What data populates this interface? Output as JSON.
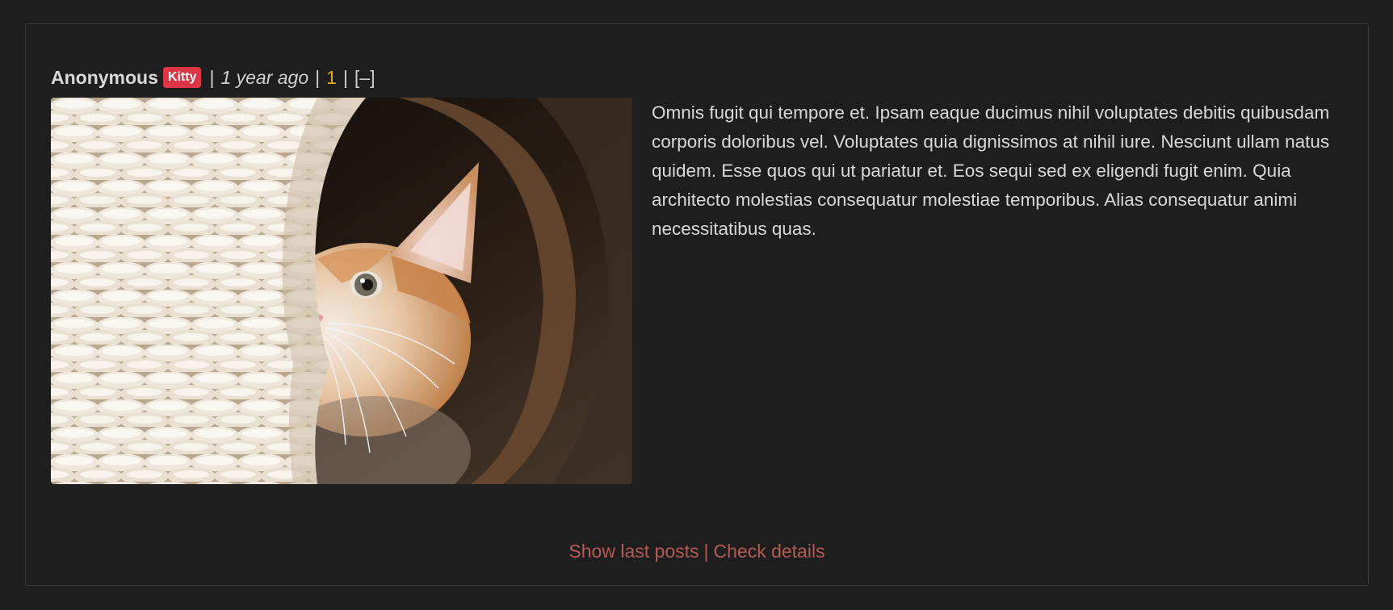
{
  "post": {
    "author": "Anonymous",
    "badge": "Kitty",
    "separator": "|",
    "timestamp": "1 year ago",
    "post_number": "1",
    "collapse_label": "[–]",
    "image_subject": "kitten-peeking-from-wicker-basket",
    "body": "Omnis fugit qui tempore et. Ipsam eaque ducimus nihil voluptates debitis quibusdam corporis doloribus vel. Voluptates quia dignissimos at nihil iure. Nesciunt ullam natus quidem. Esse quos qui ut pariatur et. Eos sequi sed ex eligendi fugit enim. Quia architecto molestias consequatur molestiae temporibus. Alias consequatur animi necessitatibus quas."
  },
  "footer": {
    "show_last_posts": "Show last posts",
    "separator": "|",
    "check_details": "Check details"
  },
  "colors": {
    "background": "#1e1e1e",
    "badge": "#dc3545",
    "post_number": "#e6a817",
    "footer_link": "#b65a54"
  }
}
